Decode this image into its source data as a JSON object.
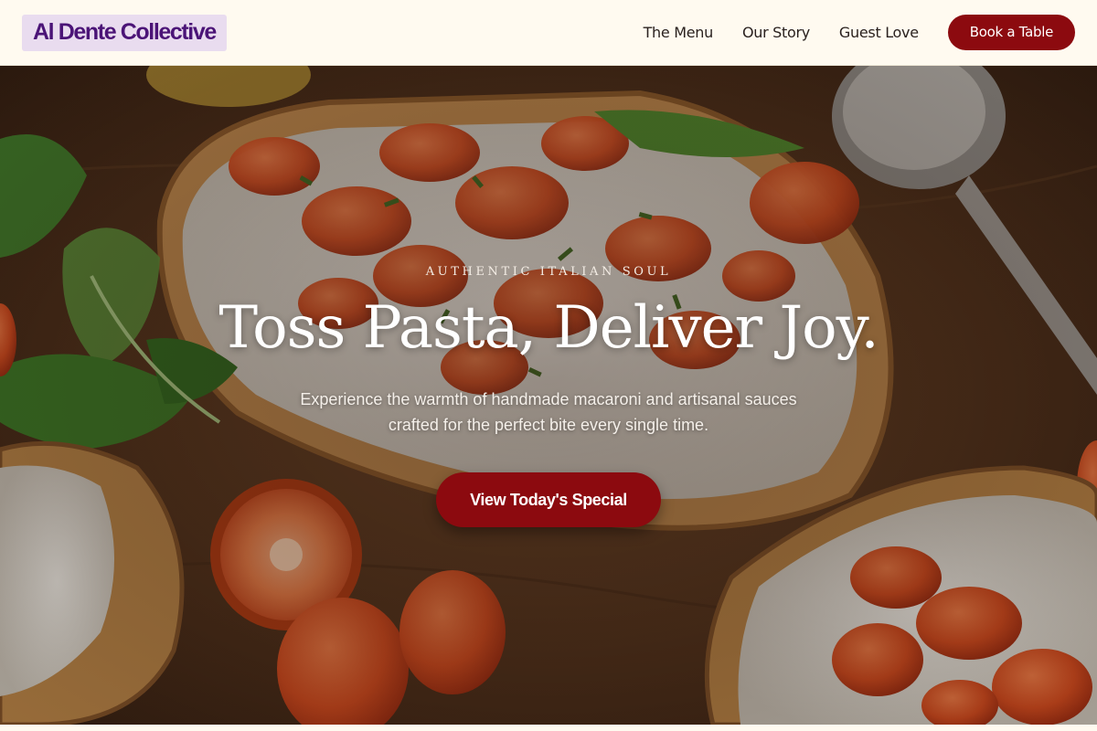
{
  "header": {
    "logo": "Al Dente Collective",
    "nav": [
      {
        "label": "The Menu"
      },
      {
        "label": "Our Story"
      },
      {
        "label": "Guest Love"
      }
    ],
    "cta_label": "Book a Table"
  },
  "hero": {
    "eyebrow": "AUTHENTIC ITALIAN SOUL",
    "headline": "Toss Pasta, Deliver Joy.",
    "subline": "Experience the warmth of handmade macaroni and artisanal sauces crafted for the perfect bite every single time.",
    "button_label": "View Today's Special",
    "image": "bruschetta-photo"
  },
  "colors": {
    "accent": "#8c0a0f",
    "header_bg": "#fffaf0",
    "logo_bg": "#e9dcef",
    "logo_text": "#4b1477"
  }
}
